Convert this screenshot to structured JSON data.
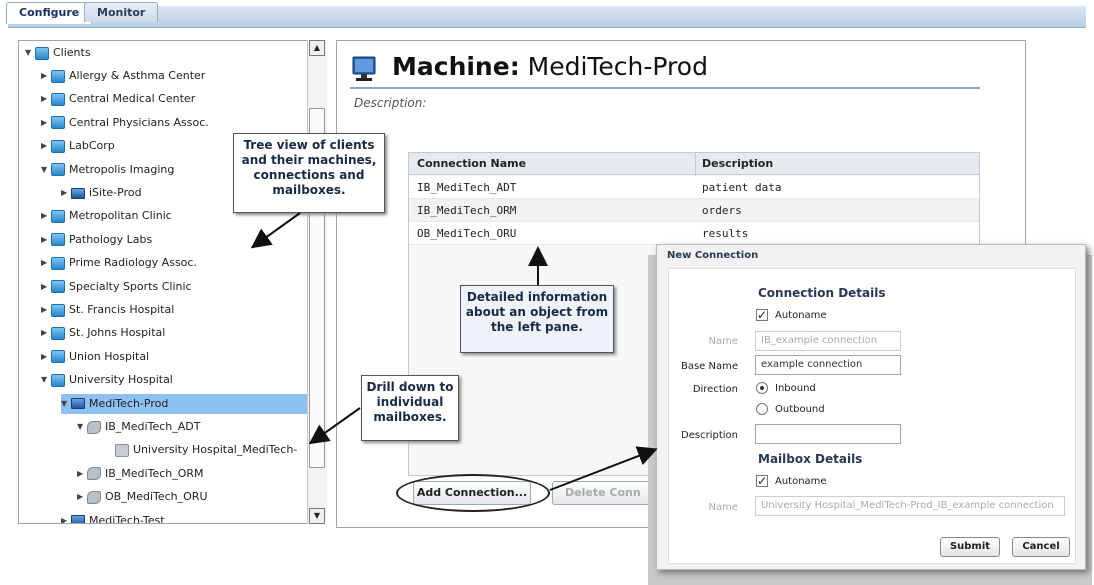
{
  "tabs": [
    {
      "label": "Configure",
      "active": true
    },
    {
      "label": "Monitor",
      "active": false
    }
  ],
  "tree": {
    "root": "Clients",
    "items": [
      {
        "label": "Allergy & Asthma Center",
        "type": "client",
        "expanded": false
      },
      {
        "label": "Central Medical Center",
        "type": "client",
        "expanded": false
      },
      {
        "label": "Central Physicians Assoc.",
        "type": "client",
        "expanded": false
      },
      {
        "label": "LabCorp",
        "type": "client",
        "expanded": false
      },
      {
        "label": "Metropolis Imaging",
        "type": "client",
        "expanded": true
      },
      {
        "label": "iSite-Prod",
        "type": "machine",
        "expanded": false
      },
      {
        "label": "Metropolitan Clinic",
        "type": "client",
        "expanded": false
      },
      {
        "label": "Pathology Labs",
        "type": "client",
        "expanded": false
      },
      {
        "label": "Prime Radiology Assoc.",
        "type": "client",
        "expanded": false
      },
      {
        "label": "Specialty Sports Clinic",
        "type": "client",
        "expanded": false
      },
      {
        "label": "St. Francis Hospital",
        "type": "client",
        "expanded": false
      },
      {
        "label": "St. Johns Hospital",
        "type": "client",
        "expanded": false
      },
      {
        "label": "Union Hospital",
        "type": "client",
        "expanded": false
      },
      {
        "label": "University Hospital",
        "type": "client",
        "expanded": true
      },
      {
        "label": "MediTech-Prod",
        "type": "machine",
        "expanded": true,
        "selected": true
      },
      {
        "label": "IB_MediTech_ADT",
        "type": "connection",
        "expanded": true
      },
      {
        "label": "University Hospital_MediTech-",
        "type": "mailbox"
      },
      {
        "label": "IB_MediTech_ORM",
        "type": "connection",
        "expanded": false
      },
      {
        "label": "OB_MediTech_ORU",
        "type": "connection",
        "expanded": false
      },
      {
        "label": "MediTech-Test",
        "type": "machine",
        "expanded": false
      }
    ]
  },
  "detail": {
    "title_prefix": "Machine:",
    "title_name": "MediTech-Prod",
    "description_label": "Description:",
    "columns": [
      "Connection Name",
      "Description"
    ],
    "rows": [
      {
        "name": "IB_MediTech_ADT",
        "description": "patient data"
      },
      {
        "name": "IB_MediTech_ORM",
        "description": "orders"
      },
      {
        "name": "OB_MediTech_ORU",
        "description": "results"
      }
    ],
    "add_button": "Add Connection...",
    "delete_button": "Delete Conn"
  },
  "callouts": {
    "tree": "Tree view of clients and their machines, connections and mailboxes.",
    "drill": "Drill down to individual mailboxes.",
    "detail": "Detailed information about an object from the left pane."
  },
  "dialog": {
    "title": "New Connection",
    "connection_section": "Connection Details",
    "autoname_label": "Autoname",
    "autoname_checked": true,
    "name_label": "Name",
    "name_value": "IB_example connection",
    "base_name_label": "Base Name",
    "base_name_value": "example connection",
    "direction_label": "Direction",
    "direction_options": [
      "Inbound",
      "Outbound"
    ],
    "direction_selected": "Inbound",
    "description_label": "Description",
    "description_value": "",
    "mailbox_section": "Mailbox Details",
    "mailbox_autoname_label": "Autoname",
    "mailbox_autoname_checked": true,
    "mailbox_name_label": "Name",
    "mailbox_name_value": "University Hospital_MediTech-Prod_IB_example connection",
    "submit_label": "Submit",
    "cancel_label": "Cancel"
  }
}
